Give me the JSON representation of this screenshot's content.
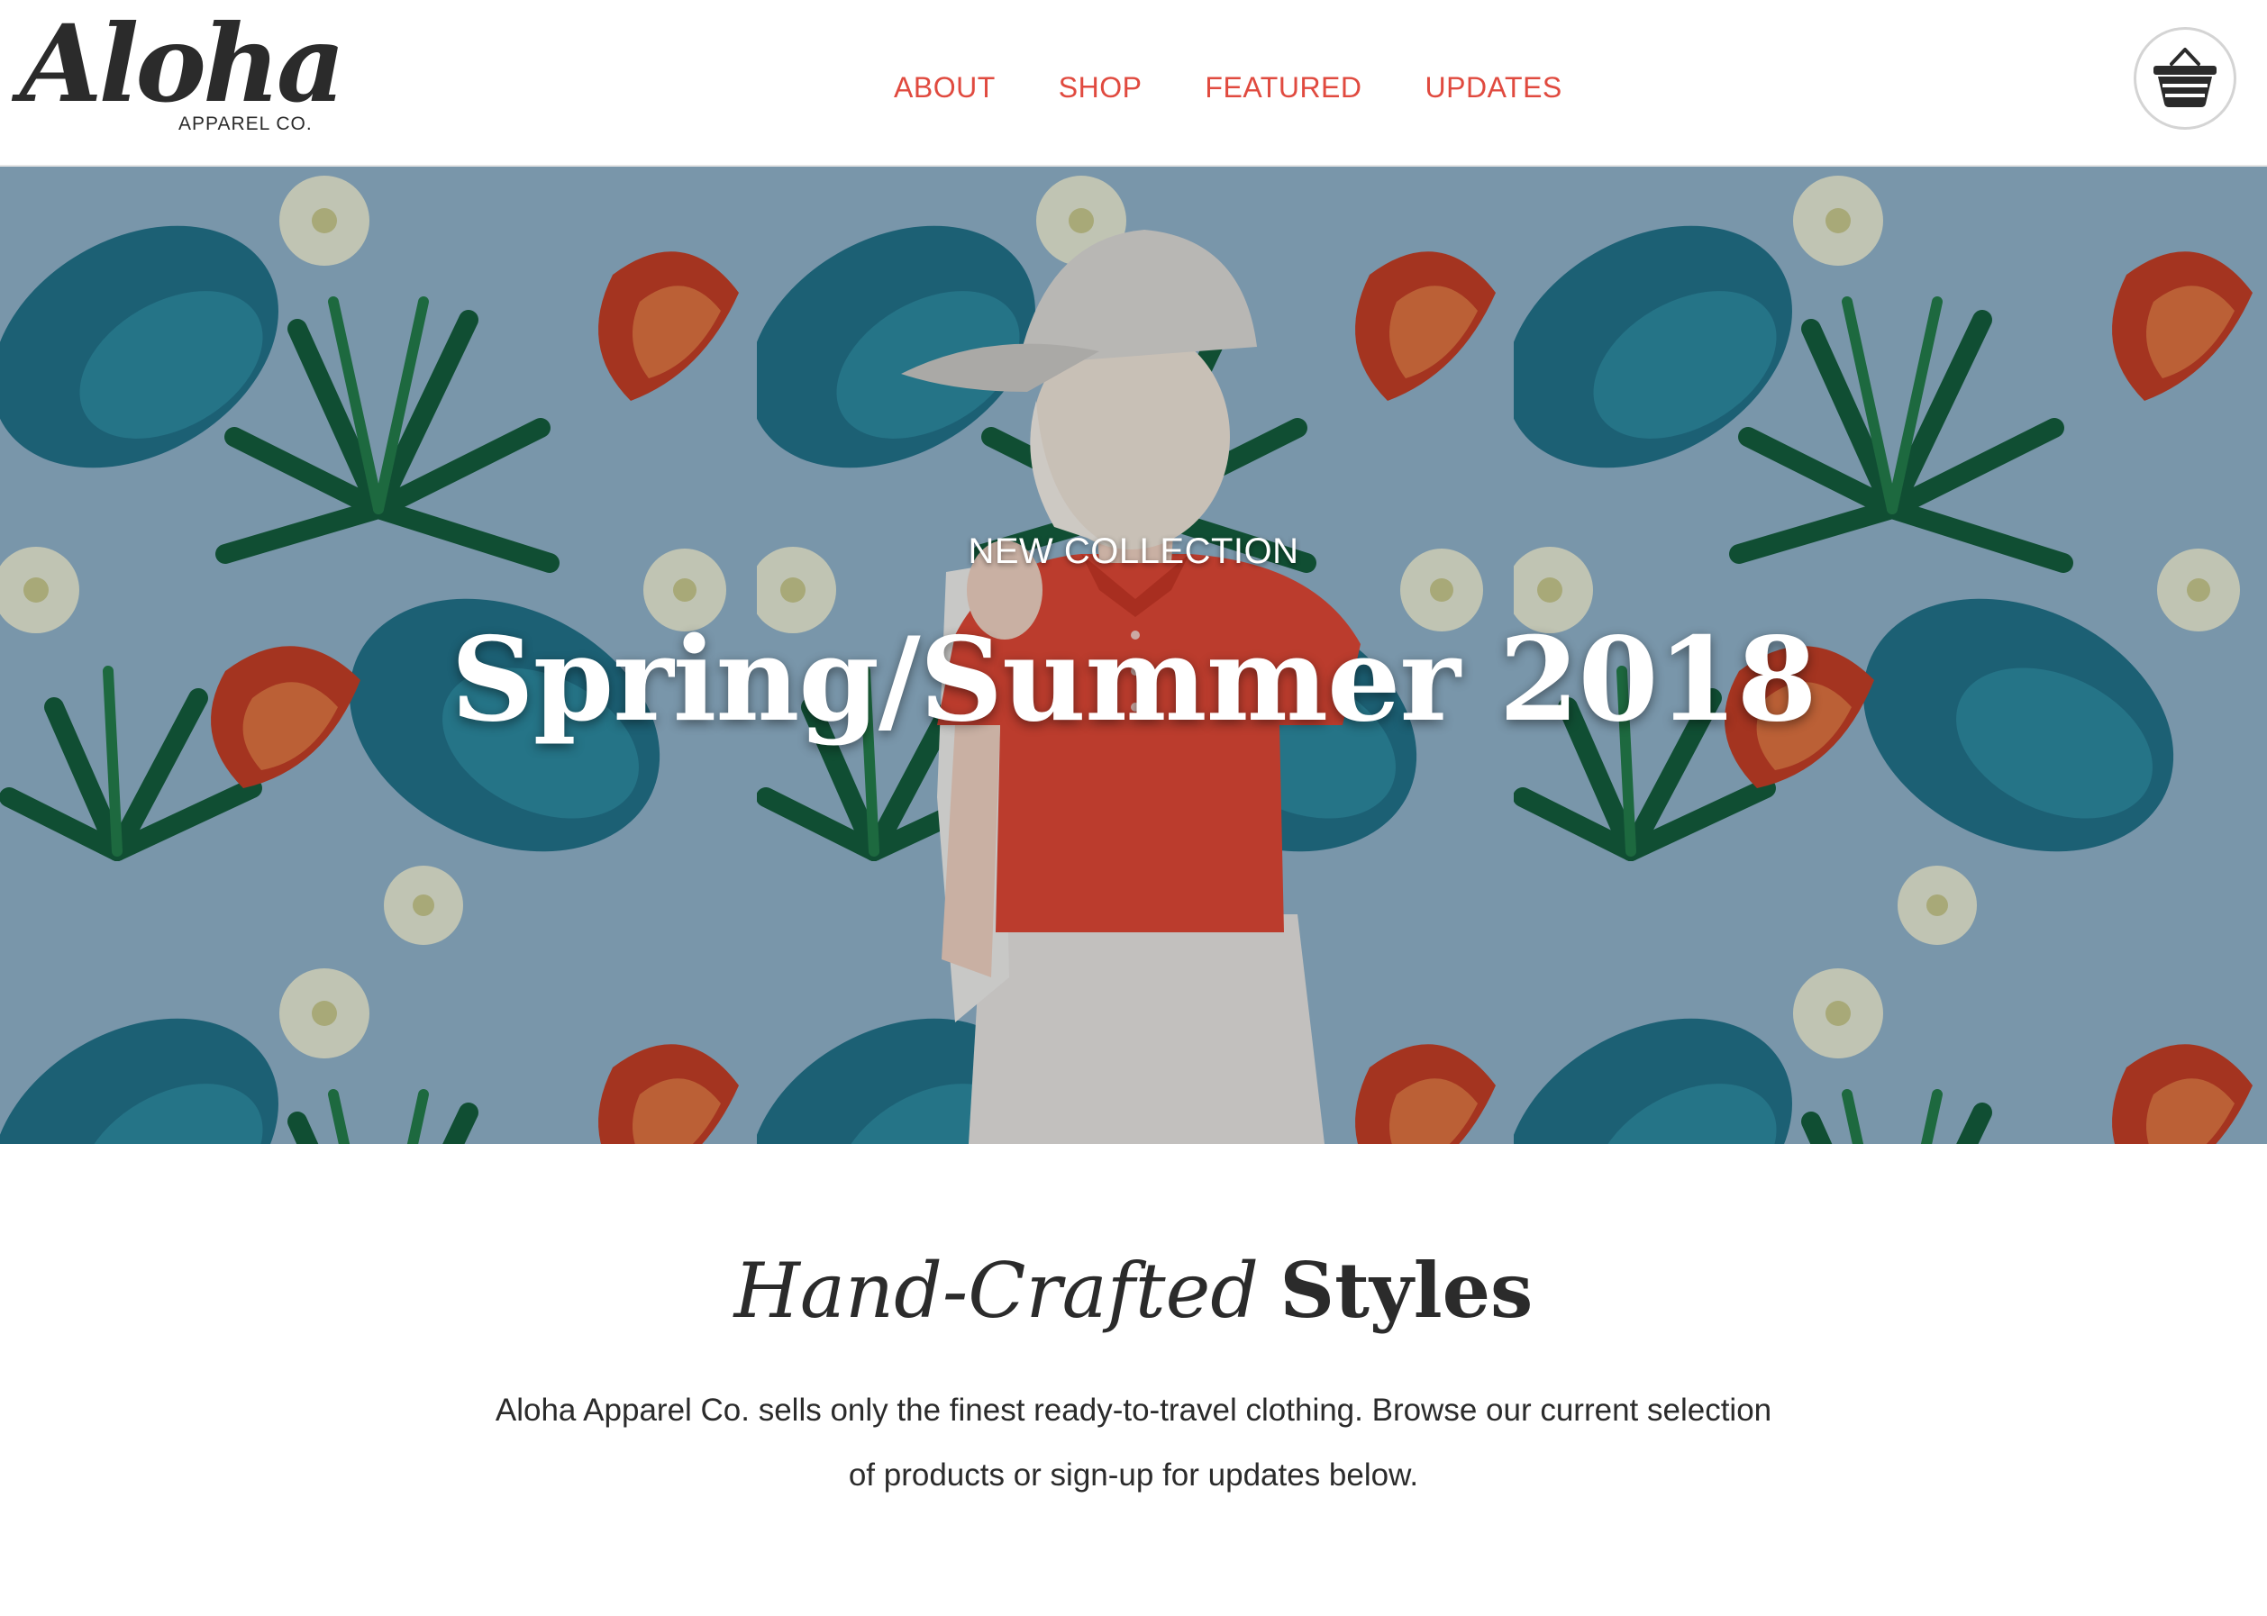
{
  "brand": {
    "logo_word": "Aloha",
    "logo_sub": "APPAREL CO."
  },
  "nav": {
    "items": [
      {
        "label": "ABOUT"
      },
      {
        "label": "SHOP"
      },
      {
        "label": "FEATURED"
      },
      {
        "label": "UPDATES"
      }
    ],
    "link_color": "#e04a3f"
  },
  "cart": {
    "icon": "basket-icon"
  },
  "hero": {
    "kicker": "NEW COLLECTION",
    "title": "Spring/Summer 2018",
    "image": "tropical-floral-pattern-with-model-in-red-polo"
  },
  "intro": {
    "title_italic": "Hand-Crafted",
    "title_bold": "Styles",
    "text": "Aloha Apparel Co. sells only the finest ready-to-travel clothing. Browse our current selection of products or sign-up for updates below."
  }
}
